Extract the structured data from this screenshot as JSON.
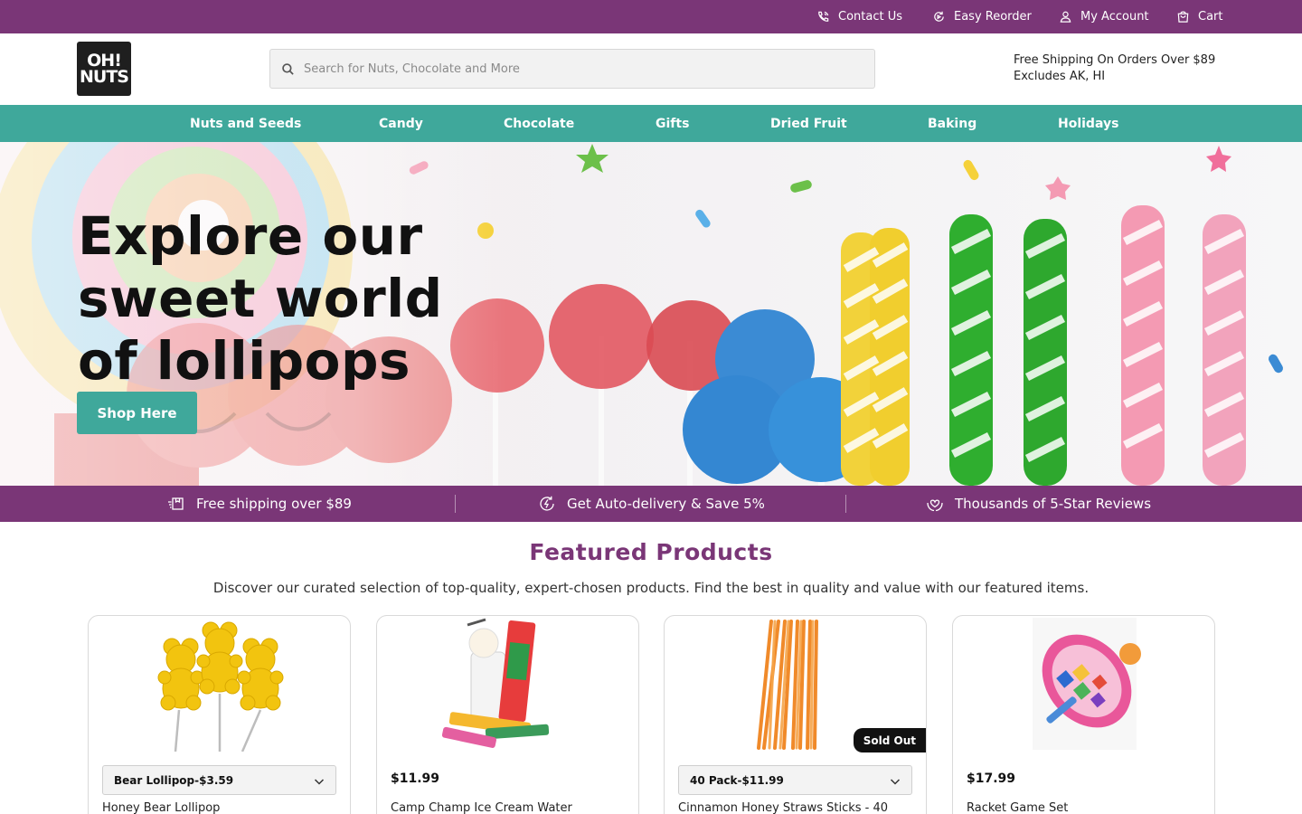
{
  "topbar": {
    "contact_label": "Contact Us",
    "reorder_label": "Easy Reorder",
    "account_label": "My Account",
    "cart_label": "Cart",
    "background": "#7a3677"
  },
  "header": {
    "logo_line1": "OH!",
    "logo_line2": "NUTS",
    "search_placeholder": "Search for Nuts, Chocolate and More",
    "shipping_line1": "Free Shipping On Orders Over $89",
    "shipping_line2": "Excludes AK, HI"
  },
  "nav": {
    "background": "#3fa89b",
    "items": [
      {
        "label": "Nuts and Seeds"
      },
      {
        "label": "Candy"
      },
      {
        "label": "Chocolate"
      },
      {
        "label": "Gifts"
      },
      {
        "label": "Dried Fruit"
      },
      {
        "label": "Baking"
      },
      {
        "label": "Holidays"
      }
    ]
  },
  "hero": {
    "heading_line1": "Explore our",
    "heading_line2": "sweet world",
    "heading_line3": "of lollipops",
    "cta_label": "Shop Here"
  },
  "benefits": [
    {
      "label": "Free shipping over $89",
      "icon": "shipping-box-icon"
    },
    {
      "label": "Get Auto-delivery & Save 5%",
      "icon": "auto-delivery-icon"
    },
    {
      "label": "Thousands of 5-Star Reviews",
      "icon": "heart-hands-icon"
    }
  ],
  "featured": {
    "title": "Featured Products",
    "subtitle": "Discover our curated selection of top-quality, expert-chosen products. Find the best in quality and value with our featured items.",
    "products": [
      {
        "name": "Honey Bear Lollipop",
        "variant": "Bear Lollipop-$3.59",
        "sold_out": false
      },
      {
        "name": "Camp Champ Ice Cream Water",
        "price": "$11.99",
        "sold_out": false
      },
      {
        "name": "Cinnamon Honey Straws Sticks - 40",
        "variant": "40 Pack-$11.99",
        "sold_out": true,
        "sold_out_label": "Sold Out"
      },
      {
        "name": "Racket Game Set",
        "price": "$17.99",
        "sold_out": false
      }
    ]
  }
}
